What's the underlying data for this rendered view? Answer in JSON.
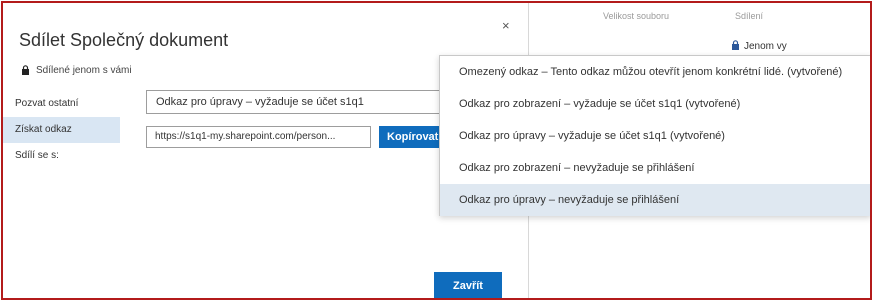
{
  "background": {
    "col_file_size": "Velikost souboru",
    "col_sharing": "Sdílení",
    "row_sharing": "Jenom vy"
  },
  "dialog": {
    "title": "Sdílet Společný dokument",
    "close_glyph": "×",
    "shared_status": "Sdílené jenom s vámi",
    "nav": [
      "Pozvat ostatní",
      "Získat odkaz",
      "Sdílí se s:"
    ],
    "selected_link_type": "Odkaz pro úpravy – vyžaduje se účet s1q1",
    "url_value": "https://s1q1-my.sharepoint.com/person...",
    "copy_label": "Kopírovat",
    "close_label": "Zavřít"
  },
  "dropdown": {
    "options": [
      "Omezený odkaz – Tento odkaz můžou otevřít jenom konkrétní lidé. (vytvořené)",
      "Odkaz pro zobrazení – vyžaduje se účet s1q1 (vytvořené)",
      "Odkaz pro úpravy – vyžaduje se účet s1q1 (vytvořené)",
      "Odkaz pro zobrazení – nevyžaduje se přihlášení",
      "Odkaz pro úpravy – nevyžaduje se přihlášení"
    ],
    "highlighted_index": 4
  },
  "colors": {
    "accent": "#0f6cbd",
    "frame": "#b31b1b",
    "highlight": "#dfe8f1",
    "nav_active": "#d9e6f3"
  }
}
